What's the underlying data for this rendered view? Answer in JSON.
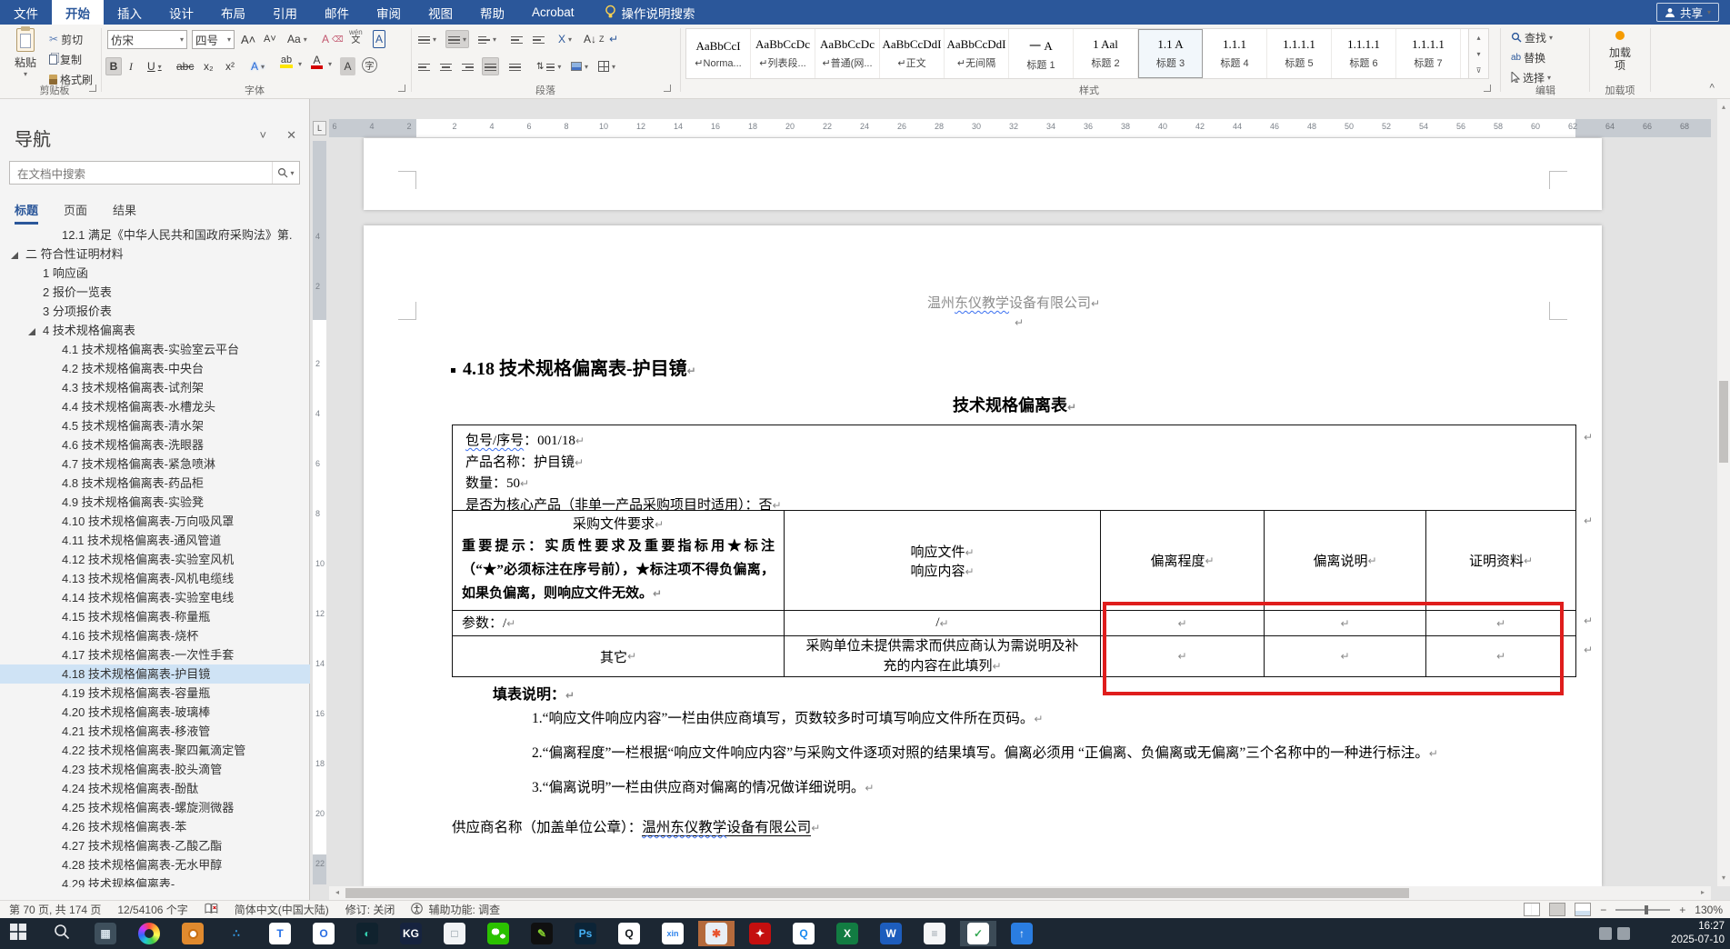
{
  "marks": {
    "pilcrow": "↵",
    "dropdown": "▾",
    "collapse": "˄"
  },
  "ribbon": {
    "tabs": [
      "文件",
      "开始",
      "插入",
      "设计",
      "布局",
      "引用",
      "邮件",
      "审阅",
      "视图",
      "帮助",
      "Acrobat"
    ],
    "active_tab": "开始",
    "tellme": "操作说明搜索",
    "share": "共享",
    "clipboard": {
      "paste": "粘贴",
      "cut": "剪切",
      "copy": "复制",
      "painter": "格式刷",
      "label": "剪贴板"
    },
    "font": {
      "name": "仿宋",
      "size": "四号",
      "bold": "B",
      "italic": "I",
      "underline": "U",
      "strike": "abc",
      "subscript": "x₂",
      "superscript": "x²",
      "case": "Aa",
      "phonetic": "文",
      "circle": "字",
      "color_letter": "A",
      "label": "字体"
    },
    "paragraph": {
      "label": "段落",
      "sort": "A↓",
      "cjk": "X"
    },
    "styles": {
      "label": "样式",
      "cells": [
        {
          "preview": "AaBbCcI",
          "label": "Norma...",
          "mark": true
        },
        {
          "preview": "AaBbCcDc",
          "label": "列表段...",
          "mark": true
        },
        {
          "preview": "AaBbCcDc",
          "label": "普通(网...",
          "mark": true
        },
        {
          "preview": "AaBbCcDdI",
          "label": "正文",
          "mark": true
        },
        {
          "preview": "AaBbCcDdI",
          "label": "无间隔",
          "mark": true
        },
        {
          "preview": "一 A",
          "label": "标题 1"
        },
        {
          "preview": "1 Aal",
          "label": "标题 2"
        },
        {
          "preview": "1.1 A",
          "label": "标题 3",
          "selected": true
        },
        {
          "preview": "1.1.1",
          "label": "标题 4"
        },
        {
          "preview": "1.1.1.1",
          "label": "标题 5"
        },
        {
          "preview": "1.1.1.1",
          "label": "标题 6"
        },
        {
          "preview": "1.1.1.1",
          "label": "标题 7"
        }
      ]
    },
    "editing": {
      "find": "查找",
      "replace": "替换",
      "select": "选择",
      "label": "编辑"
    },
    "addins": {
      "button": "加载项",
      "label": "加载项"
    }
  },
  "nav": {
    "title": "导航",
    "search_placeholder": "在文档中搜索",
    "tabs": [
      "标题",
      "页面",
      "结果"
    ],
    "active_tab": "标题",
    "items": [
      {
        "text": "12.1 满足《中华人民共和国政府采购法》第.",
        "depth": 2
      },
      {
        "text": "二 符合性证明材料",
        "depth": 0,
        "arrow": true
      },
      {
        "text": "1 响应函",
        "depth": 1
      },
      {
        "text": "2 报价一览表",
        "depth": 1
      },
      {
        "text": "3 分项报价表",
        "depth": 1
      },
      {
        "text": "4 技术规格偏离表",
        "depth": 1,
        "arrow": true
      },
      {
        "text": "4.1 技术规格偏离表-实验室云平台",
        "depth": 2
      },
      {
        "text": "4.2 技术规格偏离表-中央台",
        "depth": 2
      },
      {
        "text": "4.3 技术规格偏离表-试剂架",
        "depth": 2
      },
      {
        "text": "4.4 技术规格偏离表-水槽龙头",
        "depth": 2
      },
      {
        "text": "4.5 技术规格偏离表-清水架",
        "depth": 2
      },
      {
        "text": "4.6 技术规格偏离表-洗眼器",
        "depth": 2
      },
      {
        "text": "4.7 技术规格偏离表-紧急喷淋",
        "depth": 2
      },
      {
        "text": "4.8 技术规格偏离表-药品柜",
        "depth": 2
      },
      {
        "text": "4.9 技术规格偏离表-实验凳",
        "depth": 2
      },
      {
        "text": "4.10 技术规格偏离表-万向吸风罩",
        "depth": 2
      },
      {
        "text": "4.11 技术规格偏离表-通风管道",
        "depth": 2
      },
      {
        "text": "4.12 技术规格偏离表-实验室风机",
        "depth": 2
      },
      {
        "text": "4.13 技术规格偏离表-风机电缆线",
        "depth": 2
      },
      {
        "text": "4.14 技术规格偏离表-实验室电线",
        "depth": 2
      },
      {
        "text": "4.15 技术规格偏离表-称量瓶",
        "depth": 2
      },
      {
        "text": "4.16 技术规格偏离表-烧杯",
        "depth": 2
      },
      {
        "text": "4.17 技术规格偏离表-一次性手套",
        "depth": 2
      },
      {
        "text": "4.18 技术规格偏离表-护目镜",
        "depth": 2,
        "selected": true
      },
      {
        "text": "4.19 技术规格偏离表-容量瓶",
        "depth": 2
      },
      {
        "text": "4.20 技术规格偏离表-玻璃棒",
        "depth": 2
      },
      {
        "text": "4.21 技术规格偏离表-移液管",
        "depth": 2
      },
      {
        "text": "4.22 技术规格偏离表-聚四氟滴定管",
        "depth": 2
      },
      {
        "text": "4.23 技术规格偏离表-胶头滴管",
        "depth": 2
      },
      {
        "text": "4.24 技术规格偏离表-酚酞",
        "depth": 2
      },
      {
        "text": "4.25 技术规格偏离表-螺旋测微器",
        "depth": 2
      },
      {
        "text": "4.26 技术规格偏离表-苯",
        "depth": 2
      },
      {
        "text": "4.27 技术规格偏离表-乙酸乙酯",
        "depth": 2
      },
      {
        "text": "4.28 技术规格偏离表-无水甲醇",
        "depth": 2
      },
      {
        "text": "4.29 技术规格偏离表-",
        "depth": 2
      }
    ]
  },
  "doc": {
    "header_company": {
      "pre": "温州",
      "wavy": "东仪教学",
      "post": "设备有限公司"
    },
    "heading": "4.18  技术规格偏离表-护目镜",
    "subtitle": "技术规格偏离表",
    "table": {
      "info": {
        "l1_wavy": "包号/序号",
        "l1_rest": "：001/18",
        "l2": "产品名称：护目镜",
        "l3": "数量：50",
        "l4": "是否为核心产品（非单一产品采购项目时适用）：否"
      },
      "h_col1_title": "采购文件要求",
      "h_col1_note": "重要提示：实质性要求及重要指标用★标注（“★”必须标注在序号前），★标注项不得负偏离，如果负偏离，则响应文件无效。",
      "h_col2_l1": "响应文件",
      "h_col2_l2": "响应内容",
      "h_col3": "偏离程度",
      "h_col4": "偏离说明",
      "h_col5": "证明资料",
      "param_label": "参数：/",
      "param_resp": "/",
      "other_label": "其它",
      "other_resp": "采购单位未提供需求而供应商认为需说明及补充的内容在此填列"
    },
    "notes_title": "填表说明：",
    "notes": [
      "1.“响应文件响应内容”一栏由供应商填写，页数较多时可填写响应文件所在页码。",
      "2.“偏离程度”一栏根据“响应文件响应内容”与采购文件逐项对照的结果填写。偏离必须用 “正偏离、负偏离或无偏离”三个名称中的一种进行标注。",
      "3.“偏离说明”一栏由供应商对偏离的情况做详细说明。"
    ],
    "supplier_prefix": "供应商名称（加盖单位公章）：",
    "supplier_name": {
      "wavy": "温州东仪教学",
      "rest": "设备有限公司"
    }
  },
  "ruler": {
    "h_pre": [
      6,
      4,
      2
    ],
    "h_max": 68,
    "v_pre": [
      4,
      2
    ],
    "v_max": 22
  },
  "status": {
    "page": "第 70 页, 共 174 页",
    "words": "12/54106 个字",
    "lang": "简体中文(中国大陆)",
    "track": "修订: 关闭",
    "access": "辅助功能: 调查",
    "zoom": "130%"
  },
  "taskbar": {
    "time": "16:27",
    "date": "2025-07-10",
    "icons": [
      {
        "name": "start-button",
        "glyph": "",
        "bg": "",
        "fg": ""
      },
      {
        "name": "search-icon",
        "glyph": "",
        "bg": "",
        "fg": ""
      },
      {
        "name": "calculator-icon",
        "glyph": "▦",
        "bg": "#3e4f5c",
        "fg": "#d6e2ea"
      },
      {
        "name": "color-wheel-icon",
        "glyph": "",
        "bg": "",
        "fg": ""
      },
      {
        "name": "camera-app-icon",
        "glyph": "",
        "bg": "#e08a2e",
        "fg": "#fff"
      },
      {
        "name": "dots-app-icon",
        "glyph": "∴",
        "bg": "",
        "fg": "#35a3f1"
      },
      {
        "name": "docs-app-icon",
        "glyph": "T",
        "bg": "#ffffff",
        "fg": "#2470e8"
      },
      {
        "name": "ring-app-icon",
        "glyph": "O",
        "bg": "#ffffff",
        "fg": "#2b6fe3"
      },
      {
        "name": "globe-app-icon",
        "glyph": "◐",
        "bg": "#10222e",
        "fg": "#35d0b0"
      },
      {
        "name": "kugou-music-icon",
        "glyph": "KG",
        "bg": "#16233f",
        "fg": "#ffffff"
      },
      {
        "name": "utility-app-icon",
        "glyph": "□",
        "bg": "#f2f4f6",
        "fg": "#7d8c96"
      },
      {
        "name": "wechat-icon",
        "glyph": "",
        "bg": "",
        "fg": ""
      },
      {
        "name": "stylus-app-icon",
        "glyph": "✎",
        "bg": "#101010",
        "fg": "#86d12e"
      },
      {
        "name": "photoshop-icon",
        "glyph": "Ps",
        "bg": "#0c2437",
        "fg": "#45b1f5"
      },
      {
        "name": "qq-icon",
        "glyph": "Q",
        "bg": "#ffffff",
        "fg": "#14181c"
      },
      {
        "name": "xin-app-icon",
        "glyph": "xin",
        "bg": "#ffffff",
        "fg": "#2f84ec"
      },
      {
        "name": "active-swirl-app-icon",
        "glyph": "✱",
        "bg": "#e8eef5",
        "fg": "#e8542f",
        "btn": "#b46a3c"
      },
      {
        "name": "acrobat-icon",
        "glyph": "✦",
        "bg": "#c40f0f",
        "fg": "#ffffff"
      },
      {
        "name": "qq-browser-icon",
        "glyph": "Q",
        "bg": "#ffffff",
        "fg": "#1789f0"
      },
      {
        "name": "excel-icon",
        "glyph": "X",
        "bg": "#127c42",
        "fg": "#ffffff"
      },
      {
        "name": "word-icon",
        "glyph": "W",
        "bg": "#1d5dbd",
        "fg": "#ffffff"
      },
      {
        "name": "notepad-icon",
        "glyph": "≡",
        "bg": "#f5f6f7",
        "fg": "#98a2ab"
      },
      {
        "name": "green-app-icon",
        "glyph": "✓",
        "bg": "#ffffff",
        "fg": "#34a853",
        "btn": "#3c4b57"
      },
      {
        "name": "cloud-app-icon",
        "glyph": "↑",
        "bg": "#2a7de1",
        "fg": "#ffffff"
      }
    ]
  }
}
